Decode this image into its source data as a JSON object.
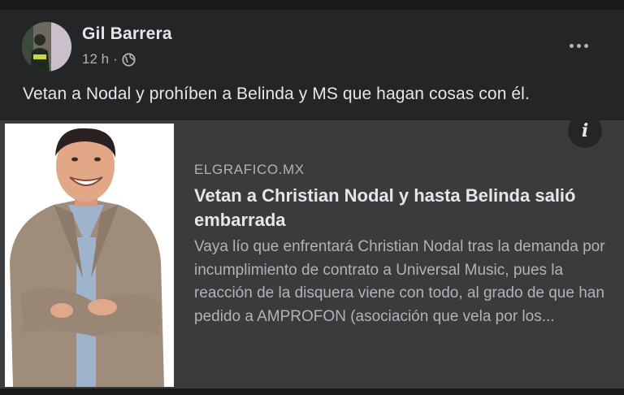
{
  "post": {
    "author": "Gil Barrera",
    "time": "12 h",
    "separator": "·",
    "privacy_icon": "globe-icon",
    "more_icon": "more-options-icon",
    "text": "Vetan a Nodal y prohíben a Belinda y MS que hagan cosas con él."
  },
  "link": {
    "domain": "ELGRAFICO.MX",
    "headline": "Vetan a Christian Nodal y hasta Belinda salió embarrada",
    "description": "Vaya lío que enfrentará Christian Nodal tras la demanda por incumplimiento de contrato a Universal Music, pues la reacción de la disquera viene con todo, al grado de que han pedido a AMPROFON (asociación que vela por los...",
    "info_label": "i"
  },
  "colors": {
    "background": "#242526",
    "card": "#3a3b3c",
    "primary_text": "#e4e6eb",
    "secondary_text": "#b0b3b8"
  }
}
